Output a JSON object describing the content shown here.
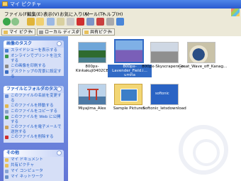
{
  "window": {
    "title": "マイ ピクチャ"
  },
  "menu": [
    "ファイル(F)",
    "編集(E)",
    "表示(V)",
    "お気に入り(A)",
    "ツール(T)",
    "ヘルプ(H)"
  ],
  "tabs": [
    {
      "label": "マイ ピクチャ"
    },
    {
      "label": "ローカル ディスク (C:)"
    },
    {
      "label": "共有ピクチャ"
    }
  ],
  "sidebar": {
    "picture_tasks": {
      "title": "画像のタスク",
      "items": [
        "スライドショーを表示する",
        "オンラインでプリントを注文する",
        "この画像を印刷する",
        "デスクトップの背景に設定する"
      ]
    },
    "file_tasks": {
      "title": "ファイルとフォルダのタスク",
      "items": [
        "このファイルの名前を変更する",
        "このファイルを移動する",
        "このファイルをコピーする",
        "このファイルを Web に公開する",
        "このファイルを電子メールで送信する",
        "このファイルを削除する"
      ]
    },
    "other_places": {
      "title": "その他",
      "items": [
        "マイ ドキュメント",
        "共有ピクチャ",
        "マイ コンピュータ",
        "マイ ネットワーク"
      ]
    }
  },
  "files": [
    {
      "name": "800px-Kinkakuji0402CB",
      "selected": false
    },
    {
      "name": "800px-Lavender_Field.i... umita",
      "selected": true
    },
    {
      "name": "800px-Skyscrapers_o...",
      "selected": false
    },
    {
      "name": "Great_Wave_off_Kanag...",
      "selected": false
    },
    {
      "name": "Miyajima_Alex",
      "selected": false
    },
    {
      "name": "Sample Pictures",
      "selected": false
    },
    {
      "name": "Softonic_letsdownload",
      "selected": false
    }
  ],
  "thumb_text": {
    "softonic": "softonic"
  }
}
